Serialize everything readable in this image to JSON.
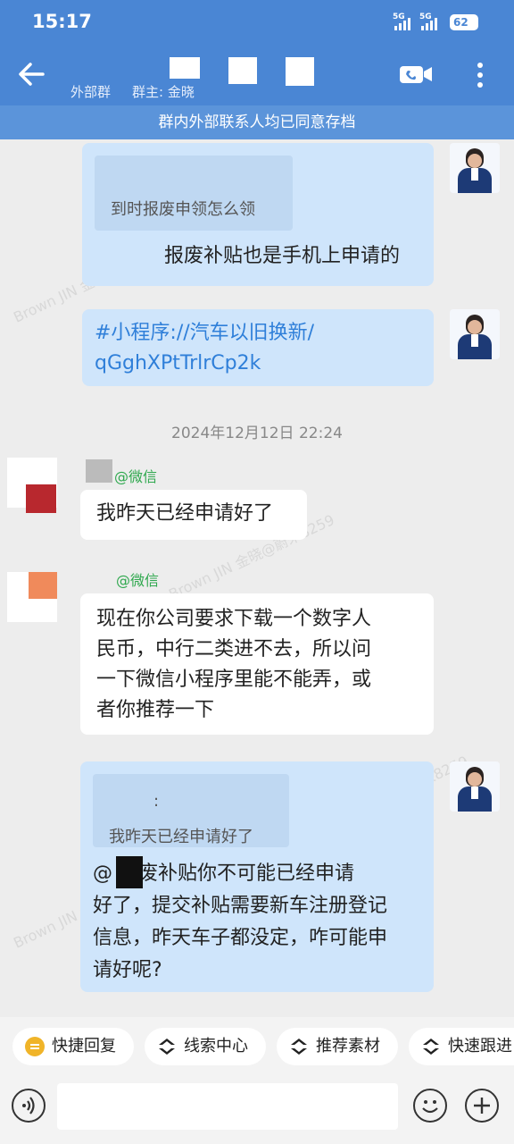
{
  "status": {
    "time": "15:17",
    "net1": "5G",
    "net2": "5G",
    "battery": "62"
  },
  "header": {
    "group_type": "外部群",
    "owner": "群主: 金晓"
  },
  "banner": "群内外部联系人均已同意存档",
  "messages": {
    "m1_quote": "到时报废申领怎么领",
    "m1_text": "报废补贴也是手机上申请的",
    "m2_line1": "#小程序://汽车以旧换新/",
    "m2_line2": "qGghXPtTrlrCp2k",
    "timestamp": "2024年12月12日  22:24",
    "m3_sender": "@微信",
    "m3_text": "我昨天已经申请好了",
    "m4_sender": "@微信",
    "m4_lines": [
      "现在你公司要求下载一个数字人",
      "民币，中行二类进不去，所以问",
      "一下微信小程序里能不能弄，或",
      "者你推荐一下"
    ],
    "m5_quote_name": ":",
    "m5_quote": "我昨天已经申请好了",
    "m5_lines": [
      "@       报废补贴你不可能已经申请",
      "好了，提交补贴需要新车注册登记",
      "信息，昨天车子都没定，咋可能申",
      "请好呢?"
    ]
  },
  "quick": [
    "快捷回复",
    "线索中心",
    "推荐素材",
    "快速跟进"
  ],
  "watermark": [
    "Brown JIN 金晓@蔚来8259"
  ],
  "colors": {
    "header": "#4a86d4",
    "mine_bubble": "#cfe5fb",
    "sender": "#2fa84e"
  }
}
